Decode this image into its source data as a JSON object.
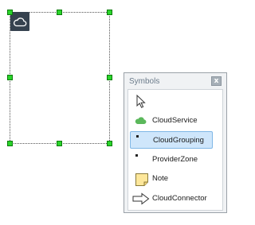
{
  "panel": {
    "title": "Symbols",
    "close_label": "x"
  },
  "symbols": [
    {
      "icon": "pointer-icon",
      "label": ""
    },
    {
      "icon": "cloud-service-icon",
      "label": "CloudService",
      "color": "#5bb85b"
    },
    {
      "icon": "cloud-grouping-icon",
      "label": "CloudGrouping",
      "selected": true
    },
    {
      "icon": "provider-zone-icon",
      "label": "ProviderZone"
    },
    {
      "icon": "note-icon",
      "label": "Note",
      "color": "#fde79b"
    },
    {
      "icon": "cloud-connector-icon",
      "label": "CloudConnector"
    }
  ],
  "canvas": {
    "selected_shape": "cloud-grouping",
    "group_icon": "cloud-icon",
    "handle_color": "#2bd42b"
  }
}
